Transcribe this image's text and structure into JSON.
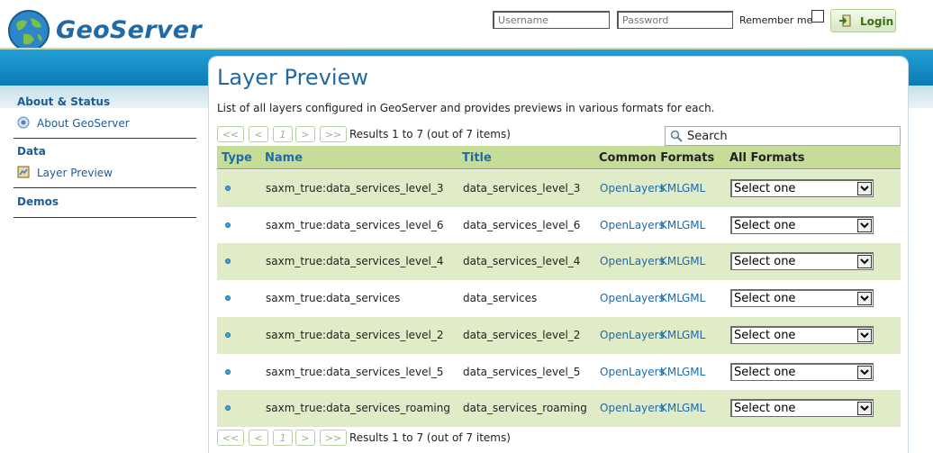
{
  "header": {
    "brand": "GeoServer",
    "username_placeholder": "Username",
    "password_placeholder": "Password",
    "remember_label": "Remember me",
    "login_label": "Login"
  },
  "sidebar": {
    "sections": [
      {
        "title": "About & Status",
        "items": [
          {
            "label": "About GeoServer",
            "icon": "info-icon"
          }
        ]
      },
      {
        "title": "Data",
        "items": [
          {
            "label": "Layer Preview",
            "icon": "layer-preview-icon"
          }
        ]
      },
      {
        "title": "Demos",
        "items": []
      }
    ]
  },
  "main": {
    "title": "Layer Preview",
    "description": "List of all layers configured in GeoServer and provides previews in various formats for each.",
    "pager": {
      "first": "<<",
      "prev": "<",
      "page": "1",
      "next": ">",
      "last": ">>",
      "results": "Results 1 to 7 (out of 7 items)"
    },
    "search_label": "Search",
    "columns": {
      "type": "Type",
      "name": "Name",
      "title": "Title",
      "common_formats": "Common Formats",
      "all_formats": "All Formats"
    },
    "rows": [
      {
        "name": "saxm_true:data_services_level_3",
        "title": "data_services_level_3",
        "formats": [
          "OpenLayers",
          "KML",
          "GML"
        ],
        "select": "Select one"
      },
      {
        "name": "saxm_true:data_services_level_6",
        "title": "data_services_level_6",
        "formats": [
          "OpenLayers",
          "KML",
          "GML"
        ],
        "select": "Select one"
      },
      {
        "name": "saxm_true:data_services_level_4",
        "title": "data_services_level_4",
        "formats": [
          "OpenLayers",
          "KML",
          "GML"
        ],
        "select": "Select one"
      },
      {
        "name": "saxm_true:data_services",
        "title": "data_services",
        "formats": [
          "OpenLayers",
          "KML",
          "GML"
        ],
        "select": "Select one"
      },
      {
        "name": "saxm_true:data_services_level_2",
        "title": "data_services_level_2",
        "formats": [
          "OpenLayers",
          "KML",
          "GML"
        ],
        "select": "Select one"
      },
      {
        "name": "saxm_true:data_services_level_5",
        "title": "data_services_level_5",
        "formats": [
          "OpenLayers",
          "KML",
          "GML"
        ],
        "select": "Select one"
      },
      {
        "name": "saxm_true:data_services_roaming",
        "title": "data_services_roaming",
        "formats": [
          "OpenLayers",
          "KML",
          "GML"
        ],
        "select": "Select one"
      }
    ]
  },
  "colors": {
    "brand_blue": "#1f6aa6",
    "header_band": "#0a78b4",
    "table_header": "#c5dd98",
    "row_alt": "#e0ebc8"
  }
}
